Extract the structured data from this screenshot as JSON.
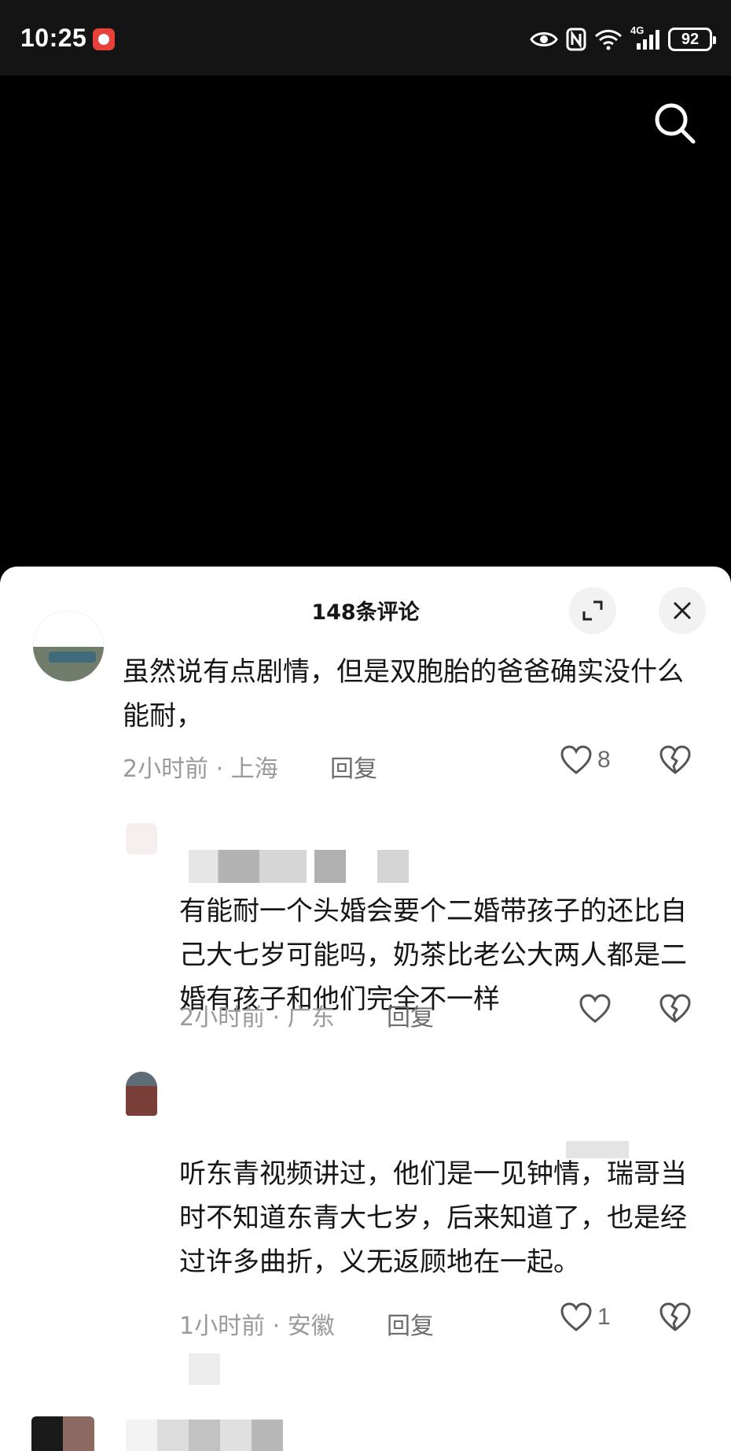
{
  "status_bar": {
    "time": "10:25",
    "network": "4G",
    "battery": "92"
  },
  "comments_panel": {
    "title": "148条评论",
    "comments": [
      {
        "text": "虽然说有点剧情，但是双胞胎的爸爸确实没什么能耐，",
        "time": "2小时前",
        "location": "上海",
        "reply": "回复",
        "likes": "8"
      },
      {
        "text": "有能耐一个头婚会要个二婚带孩子的还比自己大七岁可能吗，奶茶比老公大两人都是二婚有孩子和他们完全不一样",
        "time": "2小时前",
        "location": "广东",
        "reply": "回复",
        "likes": ""
      },
      {
        "text": "听东青视频讲过，他们是一见钟情，瑞哥当时不知道东青大七岁，后来知道了，也是经过许多曲折，义无返顾地在一起。",
        "time": "1小时前",
        "location": "安徽",
        "reply": "回复",
        "likes": "1"
      }
    ]
  },
  "icons": {
    "search": "search-icon",
    "expand": "expand-icon",
    "close": "close-icon",
    "like": "heart-icon",
    "dislike": "broken-heart-icon"
  },
  "colors": {
    "sheet_bg": "#ffffff",
    "text": "#161616",
    "meta": "#9a9a9a",
    "status_bg": "#141414"
  }
}
